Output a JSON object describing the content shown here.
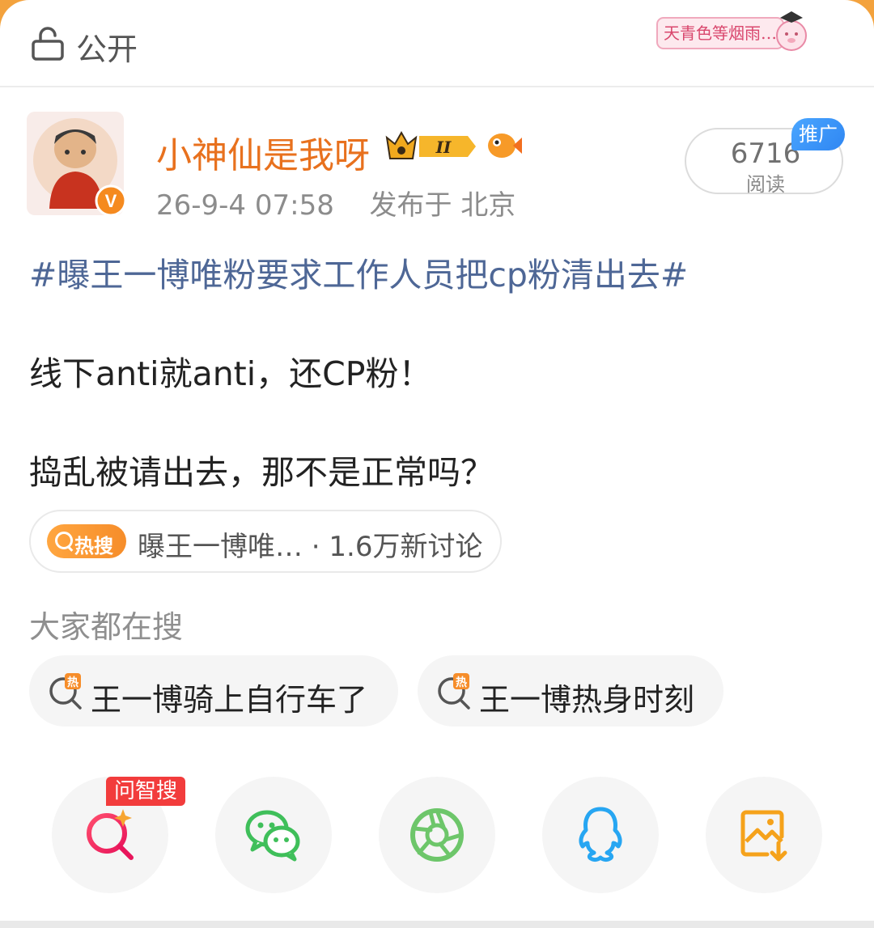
{
  "header": {
    "visibility_label": "公开",
    "sticker_text": "天青色等烟雨…"
  },
  "author": {
    "name": "小神仙是我呀",
    "timestamp": "26-9-4 07:58",
    "location": "发布于 北京",
    "reads_count": "6716",
    "reads_label": "阅读",
    "promo_tag": "推广",
    "verified_badge": "V",
    "level_badge": "II"
  },
  "post": {
    "hashtag": "#曝王一博唯粉要求工作人员把cp粉清出去#",
    "line1": "线下anti就anti，还CP粉！",
    "line2": "捣乱被请出去，那不是正常吗？"
  },
  "trend": {
    "badge": "热搜",
    "text": "曝王一博唯… · 1.6万新讨论"
  },
  "related": {
    "title": "大家都在搜",
    "items": [
      {
        "label": "王一博骑上自行车了",
        "icon": "hot-search-icon"
      },
      {
        "label": "王一博热身时刻",
        "icon": "hot-search-icon"
      }
    ]
  },
  "share": {
    "tag": "问智搜",
    "items": [
      "smart-search-icon",
      "wechat-icon",
      "moments-icon",
      "qq-icon",
      "save-image-icon"
    ]
  },
  "colors": {
    "accent_orange": "#e8711e",
    "hashtag_blue": "#4e6796",
    "promo_blue": "#3c95f7",
    "tag_red": "#f23c3c"
  }
}
